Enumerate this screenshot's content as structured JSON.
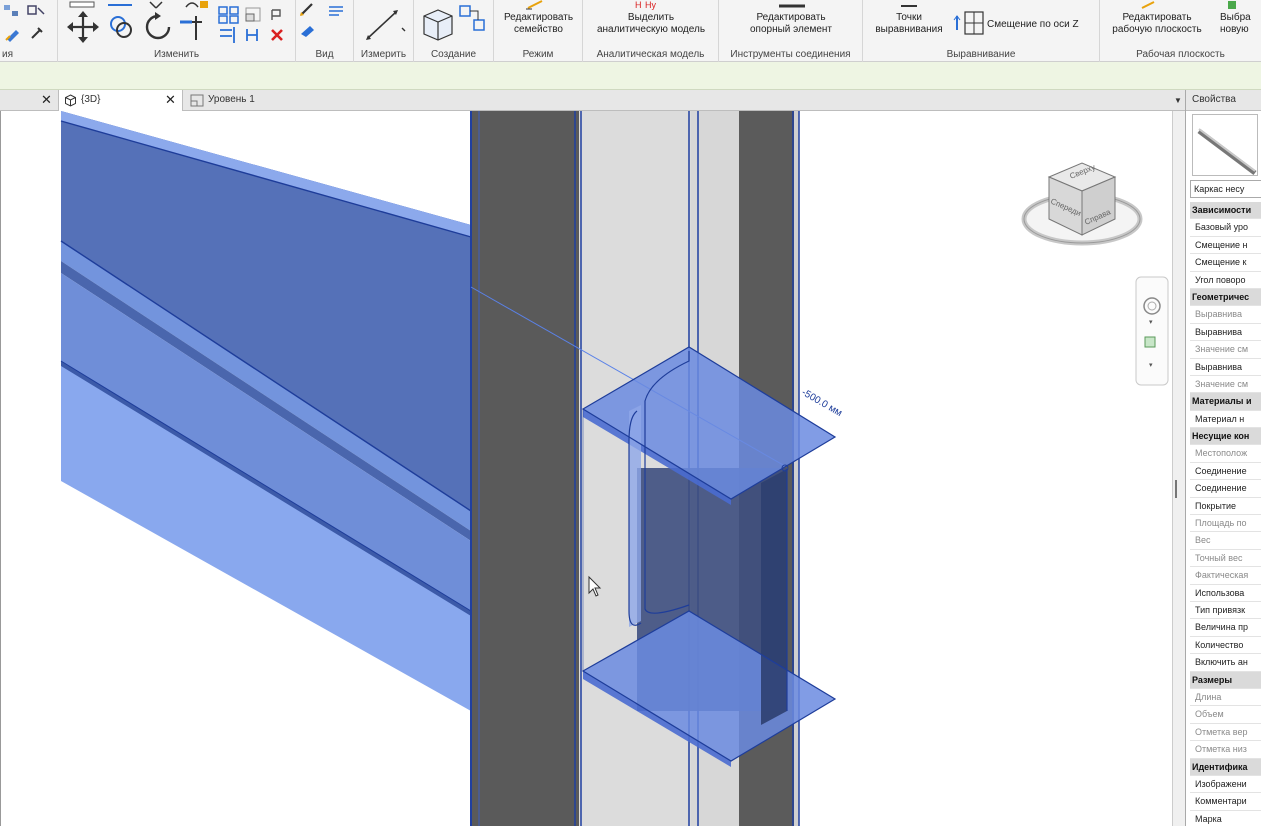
{
  "ribbon": {
    "groups": [
      {
        "label": "ия"
      },
      {
        "label": "Изменить"
      },
      {
        "label": "Вид"
      },
      {
        "label": "Измерить"
      },
      {
        "label": "Создание"
      },
      {
        "label": "Режим"
      },
      {
        "label": "Аналитическая модель"
      },
      {
        "label": "Инструменты соединения"
      },
      {
        "label": "Выравнивание"
      },
      {
        "label": "Рабочая плоскость"
      }
    ],
    "buttons": {
      "edit_family_1": "Редактировать",
      "edit_family_2": "семейство",
      "select_analytical_1": "Выделить",
      "select_analytical_2": "аналитическую модель",
      "edit_support_1": "Редактировать",
      "edit_support_2": "опорный элемент",
      "align_points_1": "Точки",
      "align_points_2": "выравнивания",
      "axis_offset": "Смещение по оси Z",
      "edit_workplane_1": "Редактировать",
      "edit_workplane_2": "рабочую плоскость",
      "pick_new_1": "Выбра",
      "pick_new_2": "новую"
    },
    "colors": {
      "delete": "#d92020",
      "accent": "#2a6fd6"
    }
  },
  "tabs": [
    {
      "label": "{3D}",
      "active": true,
      "icon": "3d-view-icon"
    },
    {
      "label": "Уровень 1",
      "active": false,
      "icon": "floor-plan-icon"
    }
  ],
  "viewport": {
    "dimension_label": "-500.0 мм",
    "viewcube": {
      "top": "Сверху",
      "front": "Спереди",
      "right": "Справа"
    }
  },
  "properties": {
    "title": "Свойства",
    "type_selector": "Каркас несу",
    "rows": [
      {
        "label": "Зависимости",
        "category": true
      },
      {
        "label": "Базовый уро"
      },
      {
        "label": "Смещение н"
      },
      {
        "label": "Смещение к"
      },
      {
        "label": "Угол поворо"
      },
      {
        "label": "Геометричес",
        "category": true
      },
      {
        "label": "Выравнива",
        "disabled": true
      },
      {
        "label": "Выравнива"
      },
      {
        "label": "Значение см",
        "disabled": true
      },
      {
        "label": "Выравнива"
      },
      {
        "label": "Значение см",
        "disabled": true
      },
      {
        "label": "Материалы и",
        "category": true
      },
      {
        "label": "Материал н"
      },
      {
        "label": "Несущие кон",
        "category": true
      },
      {
        "label": "Местополож",
        "disabled": true
      },
      {
        "label": "Соединение"
      },
      {
        "label": "Соединение"
      },
      {
        "label": "Покрытие"
      },
      {
        "label": "Площадь по",
        "disabled": true
      },
      {
        "label": "Вес",
        "disabled": true
      },
      {
        "label": "Точный вес",
        "disabled": true
      },
      {
        "label": "Фактическая",
        "disabled": true
      },
      {
        "label": "Использова"
      },
      {
        "label": "Тип привязк"
      },
      {
        "label": "Величина пр"
      },
      {
        "label": "Количество"
      },
      {
        "label": "Включить ан"
      },
      {
        "label": "Размеры",
        "category": true
      },
      {
        "label": "Длина",
        "disabled": true
      },
      {
        "label": "Объем",
        "disabled": true
      },
      {
        "label": "Отметка вер",
        "disabled": true
      },
      {
        "label": "Отметка низ",
        "disabled": true
      },
      {
        "label": "Идентифика",
        "category": true
      },
      {
        "label": "Изображени"
      },
      {
        "label": "Комментари"
      },
      {
        "label": "Марка"
      }
    ]
  }
}
